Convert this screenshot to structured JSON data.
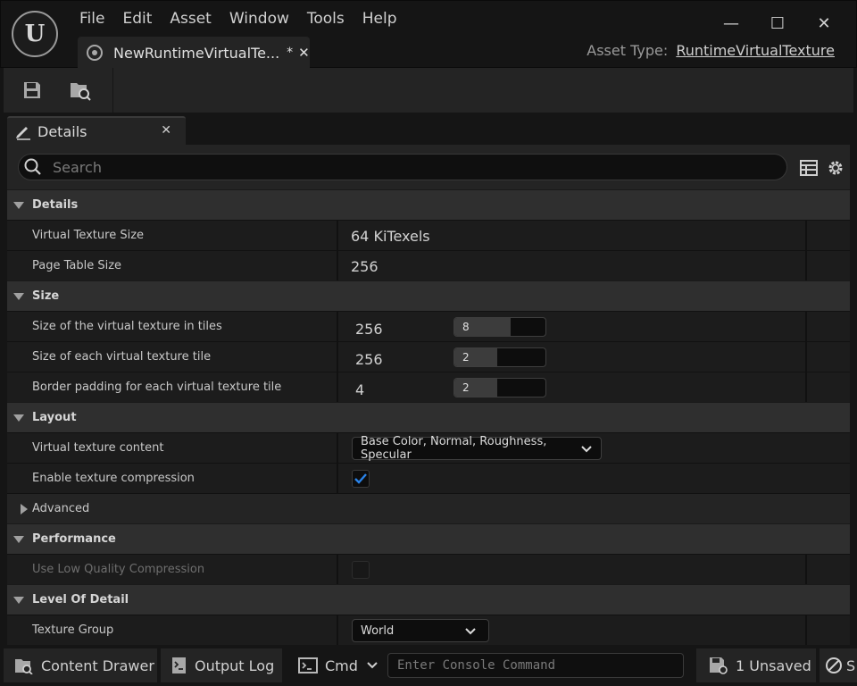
{
  "window": {
    "menu": [
      "File",
      "Edit",
      "Asset",
      "Window",
      "Tools",
      "Help"
    ],
    "minimize": "—",
    "maximize": "☐",
    "close": "✕",
    "tab": {
      "label": "NewRuntimeVirtualTe...",
      "dirty": "*",
      "close": "✕"
    },
    "asset_type_label": "Asset Type:",
    "asset_type_value": "RuntimeVirtualTexture"
  },
  "toolbar": {
    "buttons": [
      {
        "icon": "save-icon"
      },
      {
        "icon": "browse-icon"
      }
    ]
  },
  "details_panel": {
    "tab_label": "Details",
    "tab_close": "✕",
    "search_placeholder": "Search",
    "categories": [
      {
        "label": "Details",
        "expanded": true,
        "rows": [
          {
            "name": "Virtual Texture Size",
            "value": "64 KiTexels"
          },
          {
            "name": "Page Table Size",
            "value": "256"
          }
        ]
      },
      {
        "label": "Size",
        "expanded": true,
        "rows": [
          {
            "name": "Size of the virtual texture in tiles",
            "value": "256",
            "spin": "8",
            "spin_fraction": 0.62
          },
          {
            "name": "Size of each virtual texture tile",
            "value": "256",
            "spin": "2",
            "spin_fraction": 0.47
          },
          {
            "name": "Border padding for each virtual texture tile",
            "value": "4",
            "spin": "2",
            "spin_fraction": 0.47
          }
        ]
      },
      {
        "label": "Layout",
        "expanded": true,
        "rows": [
          {
            "name": "Virtual texture content",
            "value": "Base Color, Normal, Roughness, Specular"
          },
          {
            "name": "Enable texture compression",
            "checked": true
          }
        ]
      },
      {
        "label": "Advanced",
        "expanded": false
      },
      {
        "label": "Performance",
        "expanded": true,
        "rows": [
          {
            "name": "Use Low Quality Compression",
            "checked": false,
            "disabled": true
          }
        ]
      },
      {
        "label": "Level Of Detail",
        "expanded": true,
        "rows": [
          {
            "name": "Texture Group",
            "value": "World"
          }
        ]
      }
    ]
  },
  "statusbar": {
    "content_drawer": "Content Drawer",
    "output_log": "Output Log",
    "cmd": "Cmd",
    "console_placeholder": "Enter Console Command",
    "unsaved": "1 Unsaved",
    "source_control_partial": "S"
  },
  "colors": {
    "check_accent": "#2a83e8",
    "background": "#151515",
    "panel": "#242424"
  }
}
